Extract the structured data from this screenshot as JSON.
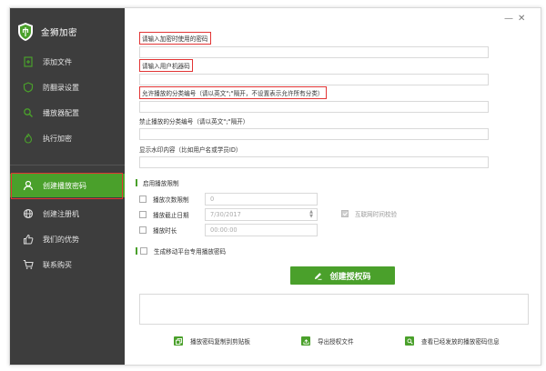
{
  "app": {
    "title": "金狮加密"
  },
  "sidebar": {
    "items": [
      {
        "label": "添加文件",
        "icon": "add-file-icon"
      },
      {
        "label": "防翻录设置",
        "icon": "shield-icon"
      },
      {
        "label": "播放器配置",
        "icon": "search-icon"
      },
      {
        "label": "执行加密",
        "icon": "fire-icon"
      },
      {
        "label": "创建播放密码",
        "icon": "user-icon",
        "active": true
      },
      {
        "label": "创建注册机",
        "icon": "globe-icon"
      },
      {
        "label": "我们的优势",
        "icon": "thumbs-up-icon"
      },
      {
        "label": "联系购买",
        "icon": "cart-icon"
      }
    ]
  },
  "window": {
    "minimize": "—",
    "close": "✕"
  },
  "form": {
    "password_label": "请输入加密时使用的密码",
    "machine_code_label": "请输入用户机器码",
    "allow_category_label": "允许播放的分类编号（请以英文\";\"隔开，不设置表示允许所有分类）",
    "forbid_category_label": "禁止播放的分类编号（请以英文\";\"隔开）",
    "watermark_label": "显示水印内容（比如用户名或学员ID）"
  },
  "limits": {
    "section_title": "启用播放限制",
    "play_count_label": "播放次数限制",
    "play_count_value": "0",
    "expiry_label": "播放截止日期",
    "expiry_value": "7/30/2017",
    "duration_label": "播放时长",
    "duration_value": "00:00:00",
    "sync_label": "互联网时间校验"
  },
  "mobile": {
    "label": "生成移动平台专用播放密码"
  },
  "actions": {
    "create_label": "创建授权码",
    "copy_label": "播放密码复制到剪贴板",
    "export_label": "导出授权文件",
    "view_label": "查看已经发放的播放密码信息"
  },
  "colors": {
    "sidebar_bg": "#3d3d3d",
    "accent": "#4aa02b",
    "highlight": "#e23434"
  }
}
